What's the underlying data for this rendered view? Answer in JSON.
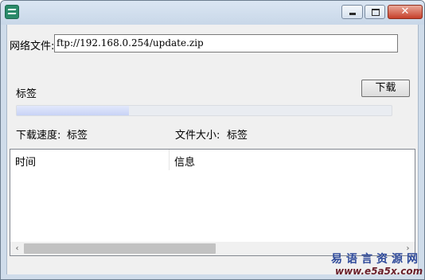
{
  "window": {
    "title": "",
    "close_glyph": "✕"
  },
  "form": {
    "file_label": "网络文件:",
    "file_url": "ftp://192.168.0.254/update.zip"
  },
  "status": {
    "label": "标签",
    "progress_fraction": 0.3
  },
  "download_button_label": "下载",
  "info": {
    "speed_caption": "下载速度:",
    "speed_value": "标签",
    "size_caption": "文件大小:",
    "size_value": "标签"
  },
  "list": {
    "columns": [
      "时间",
      "信息"
    ],
    "scroll_left": "‹",
    "scroll_right": "›"
  },
  "watermark": {
    "brand": "易语言资源网",
    "url": "www.e5a5x.com"
  }
}
